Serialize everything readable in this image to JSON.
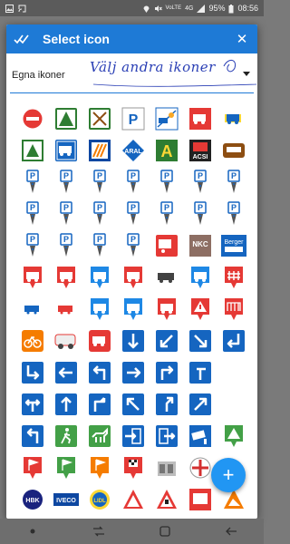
{
  "status_bar": {
    "battery": "95%",
    "time": "08:56",
    "network": "4G",
    "volte": "VoLTE"
  },
  "dialog": {
    "title": "Select icon",
    "select_all_icon": "double-check-icon",
    "close_icon": "close-icon",
    "dropdown_value": "Egna ikoner",
    "handwritten_note": "Välj andra ikoner",
    "fab_label": "+"
  },
  "icon_labels": {
    "aral": "ARAL",
    "acsi": "ACSI",
    "nkc": "NKC",
    "berger": "Berger",
    "parking": "P",
    "hbk": "HBK",
    "iveco": "IVECO",
    "lidl": "LIDL"
  },
  "colors": {
    "header": "#1e7ad6",
    "accent_fab": "#2196f3",
    "sign_blue": "#1565c0",
    "sign_red": "#e53935",
    "sign_green": "#43a047",
    "sign_orange": "#f57c00"
  },
  "icons": [
    "no-entry",
    "camping-tent",
    "picnic-cross",
    "parking-p",
    "service-caravan",
    "red-motorhome",
    "yellow-motorhome",
    "green-tent-sign",
    "blue-motorhome-sign",
    "blue-aldi",
    "aral-diamond",
    "green-a",
    "acsi-red",
    "brown-sign",
    "parking-pin-1",
    "parking-pin-2",
    "parking-pin-3",
    "parking-pin-4",
    "parking-pin-5",
    "parking-pin-6",
    "parking-pin-7",
    "parking-pin-8",
    "parking-pin-9",
    "parking-pin-10",
    "parking-pin-11",
    "parking-pin-12",
    "parking-pin-13",
    "parking-pin-14",
    "parking-pin-15",
    "parking-pin-16",
    "parking-pin-17",
    "parking-pin-18",
    "red-caravan-sign",
    "nkc-sign",
    "berger-sign",
    "red-motorhome-marker-1",
    "red-motorhome-marker-2",
    "red-motorhome-marker-3",
    "red-motorhome-marker-4",
    "small-motorhome",
    "blue-motorhome-marker",
    "red-fence-marker",
    "tiny-blue",
    "tiny-red",
    "blue-motorhome-marker-2",
    "blue-motorhome-marker-3",
    "red-motorhome-marker-5",
    "red-warning-marker",
    "red-gate-marker",
    "orange-bike",
    "motorhome-white",
    "red-motorhome-white",
    "blue-arrow-down",
    "blue-arrow-down-left",
    "blue-arrow-down-right",
    "blue-arrow-turn",
    "arrow-down-right-turn",
    "arrow-left",
    "arrow-up-left",
    "arrow-right",
    "arrow-right-turn",
    "blue-arrow-turn-2",
    "",
    "arrow-split",
    "arrow-up",
    "arrow-up-turn",
    "arrow-up-left-diag",
    "arrow-up-right",
    "arrow-up-right-diag",
    "",
    "arrow-return",
    "green-walker",
    "green-horse",
    "blue-door-in",
    "blue-door-out",
    "camera",
    "green-shelter",
    "red-flag",
    "green-flag",
    "orange-flag",
    "red-checker",
    "container",
    "cross-badge",
    "",
    "hbk-logo",
    "iveco-logo",
    "lidl-logo",
    "red-triangle",
    "red-triangle-2",
    "bus-stop",
    "orange-wild"
  ]
}
